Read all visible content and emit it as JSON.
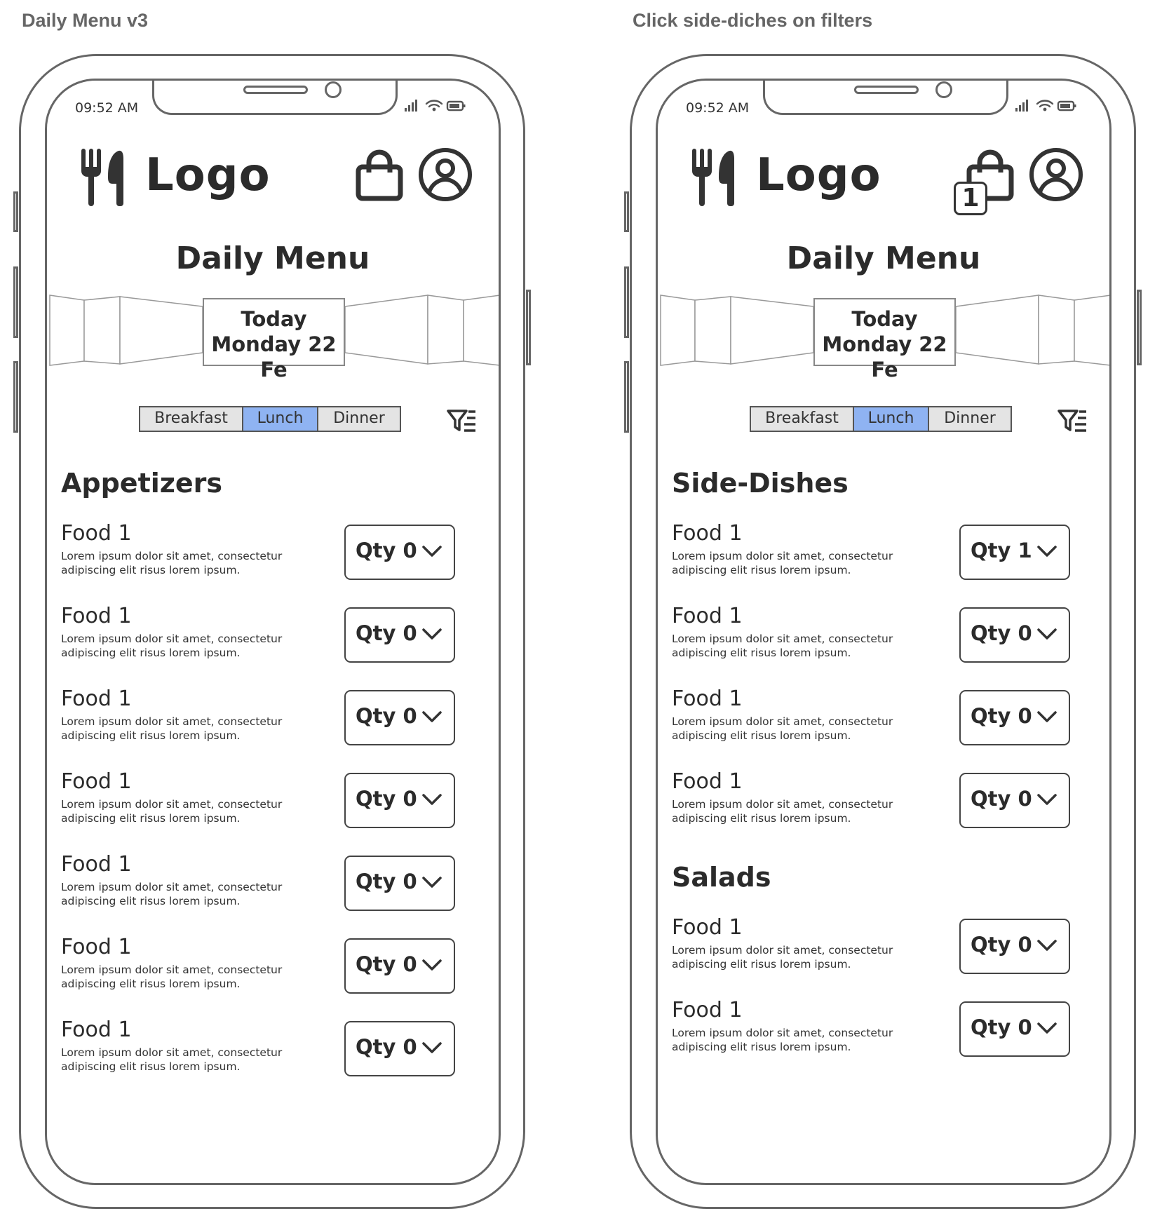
{
  "boards": [
    {
      "title": "Daily Menu v3",
      "status_time": "09:52 AM",
      "logo": "Logo",
      "cart_count": "",
      "page_title": "Daily Menu",
      "date_line1": "Today",
      "date_line2": "Monday 22 Fe",
      "meals": [
        "Breakfast",
        "Lunch",
        "Dinner"
      ],
      "active_meal": "Lunch",
      "sections": [
        {
          "title": "Appetizers",
          "items": [
            {
              "name": "Food 1",
              "desc": "Lorem ipsum dolor sit amet, consectetur adipiscing elit risus lorem ipsum.",
              "qty": "Qty 0"
            },
            {
              "name": "Food 1",
              "desc": "Lorem ipsum dolor sit amet, consectetur adipiscing elit risus lorem ipsum.",
              "qty": "Qty 0"
            },
            {
              "name": "Food 1",
              "desc": "Lorem ipsum dolor sit amet, consectetur adipiscing elit risus lorem ipsum.",
              "qty": "Qty 0"
            },
            {
              "name": "Food 1",
              "desc": "Lorem ipsum dolor sit amet, consectetur adipiscing elit risus lorem ipsum.",
              "qty": "Qty 0"
            },
            {
              "name": "Food 1",
              "desc": "Lorem ipsum dolor sit amet, consectetur adipiscing elit risus lorem ipsum.",
              "qty": "Qty 0"
            },
            {
              "name": "Food 1",
              "desc": "Lorem ipsum dolor sit amet, consectetur adipiscing elit risus lorem ipsum.",
              "qty": "Qty 0"
            },
            {
              "name": "Food 1",
              "desc": "Lorem ipsum dolor sit amet, consectetur adipiscing elit risus lorem ipsum.",
              "qty": "Qty 0"
            }
          ]
        }
      ]
    },
    {
      "title": "Click side-diches on filters",
      "status_time": "09:52 AM",
      "logo": "Logo",
      "cart_count": "1",
      "page_title": "Daily Menu",
      "date_line1": "Today",
      "date_line2": "Monday 22 Fe",
      "meals": [
        "Breakfast",
        "Lunch",
        "Dinner"
      ],
      "active_meal": "Lunch",
      "sections": [
        {
          "title": "Side-Dishes",
          "items": [
            {
              "name": "Food 1",
              "desc": "Lorem ipsum dolor sit amet, consectetur adipiscing elit risus lorem ipsum.",
              "qty": "Qty 1"
            },
            {
              "name": "Food 1",
              "desc": "Lorem ipsum dolor sit amet, consectetur adipiscing elit risus lorem ipsum.",
              "qty": "Qty 0"
            },
            {
              "name": "Food 1",
              "desc": "Lorem ipsum dolor sit amet, consectetur adipiscing elit risus lorem ipsum.",
              "qty": "Qty 0"
            },
            {
              "name": "Food 1",
              "desc": "Lorem ipsum dolor sit amet, consectetur adipiscing elit risus lorem ipsum.",
              "qty": "Qty 0"
            }
          ]
        },
        {
          "title": "Salads",
          "items": [
            {
              "name": "Food 1",
              "desc": "Lorem ipsum dolor sit amet, consectetur adipiscing elit risus lorem ipsum.",
              "qty": "Qty 0"
            },
            {
              "name": "Food 1",
              "desc": "Lorem ipsum dolor sit amet, consectetur adipiscing elit risus lorem ipsum.",
              "qty": "Qty 0"
            }
          ]
        }
      ]
    }
  ],
  "colors": {
    "active_tab": "#8fb3f2",
    "inactive_tab": "#e4e4e4",
    "stroke": "#333333"
  },
  "icons": [
    "fork-knife-icon",
    "shopping-bag-icon",
    "user-icon",
    "filter-icon",
    "chevron-down-icon",
    "signal-icon",
    "wifi-icon",
    "battery-icon"
  ]
}
